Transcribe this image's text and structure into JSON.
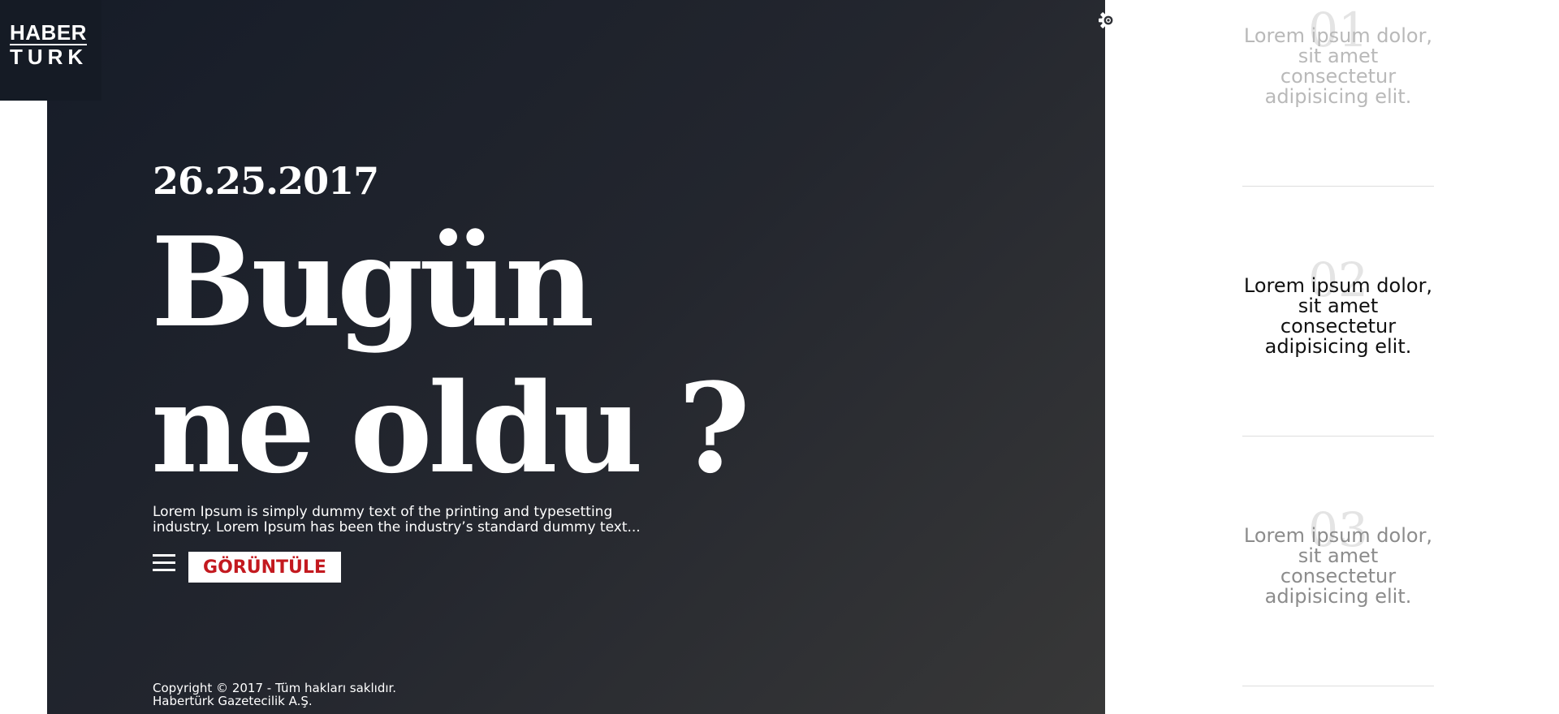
{
  "logo": {
    "line1": "HABER",
    "line2": "TURK"
  },
  "hero": {
    "date": "26.25.2017",
    "headline_line1": "Bugün",
    "headline_line2": "ne oldu ?",
    "description": "Lorem Ipsum is simply dummy text of the printing and typesetting industry. Lorem Ipsum has been the industry’s standard dummy text...",
    "button_label": "GÖRÜNTÜLE"
  },
  "footer": {
    "line1": "Copyright © 2017 - Tüm hakları saklıdır.",
    "line2": "Habertürk Gazetecilik A.Ş."
  },
  "side": {
    "items": [
      {
        "number": "01",
        "text": "Lorem ipsum dolor, sit amet consectetur adipisicing elit."
      },
      {
        "number": "02",
        "text": "Lorem ipsum dolor, sit amet consectetur adipisicing elit."
      },
      {
        "number": "03",
        "text": "Lorem ipsum dolor, sit amet consectetur adipisicing elit."
      }
    ]
  },
  "icons": {
    "settings": "gear-icon",
    "menu": "hamburger-menu-icon"
  },
  "colors": {
    "accent": "#c3191f",
    "hero_dark": "#161c28",
    "hero_light": "#383838",
    "active_text": "#111111",
    "inactive_text": "#b9b9b9"
  }
}
